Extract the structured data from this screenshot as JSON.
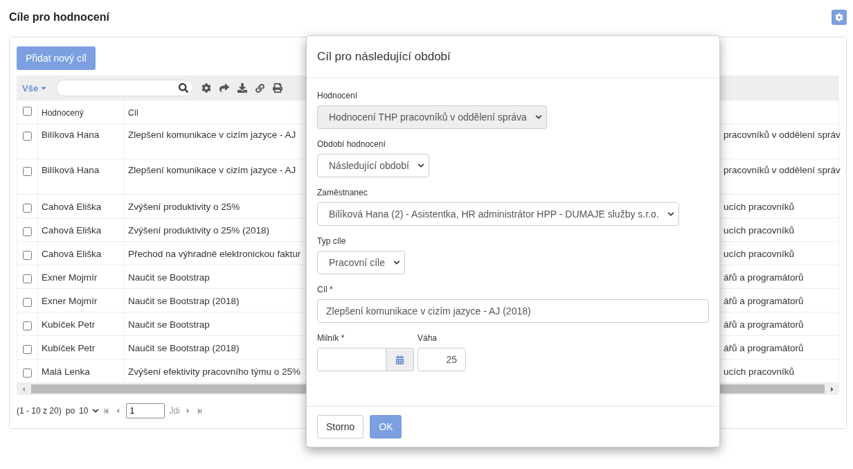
{
  "page": {
    "title": "Cíle pro hodnocení"
  },
  "add_button": "Přidat nový cíl",
  "toolbar": {
    "filter": "Vše"
  },
  "table": {
    "select_all": {
      "checked": false
    },
    "columns": [
      "Hodnocený",
      "Cíl"
    ],
    "rows": [
      {
        "checked": false,
        "tall": true,
        "person": "Bilíková Hana",
        "goal": "Zlepšení komunikace v cizím jazyce - AJ",
        "column_3": "pracovníků v oddělení správ"
      },
      {
        "checked": false,
        "tall": true,
        "person": "Bilíková Hana",
        "goal": "Zlepšení komunikace v cizím jazyce - AJ",
        "column_3": "pracovníků v oddělení správ"
      },
      {
        "checked": false,
        "tall": false,
        "person": "Cahová Eliška",
        "goal": "Zvýšení produktivity o 25%",
        "column_3": "ucích pracovníků"
      },
      {
        "checked": false,
        "tall": false,
        "person": "Cahová Eliška",
        "goal": "Zvýšení produktivity o 25% (2018)",
        "column_3": "ucích pracovníků"
      },
      {
        "checked": false,
        "tall": false,
        "person": "Cahová Eliška",
        "goal": "Přechod na výhradně elektronickou faktur",
        "column_3": "ucích pracovníků"
      },
      {
        "checked": false,
        "tall": false,
        "person": "Exner Mojmír",
        "goal": "Naučit se Bootstrap",
        "column_3": "ářů a programátorů"
      },
      {
        "checked": false,
        "tall": false,
        "person": "Exner Mojmír",
        "goal": "Naučit se Bootstrap (2018)",
        "column_3": "ářů a programátorů"
      },
      {
        "checked": false,
        "tall": false,
        "person": "Kubíček Petr",
        "goal": "Naučit se Bootstrap",
        "column_3": "ářů a programátorů"
      },
      {
        "checked": false,
        "tall": false,
        "person": "Kubíček Petr",
        "goal": "Naučit se Bootstrap (2018)",
        "column_3": "ářů a programátorů"
      },
      {
        "checked": false,
        "tall": false,
        "person": "Malá Lenka",
        "goal": "Zvýšení efektivity pracovního týmu o 25%",
        "column_3": "ucích pracovníků"
      }
    ]
  },
  "pagination": {
    "range": "(1 - 10 z 20)",
    "per_page_label": "po",
    "per_page": "10",
    "page": "1",
    "go": "Jdi"
  },
  "dialog": {
    "title": "Cíl pro následující období",
    "fields": [
      {
        "kind": "select",
        "label": "Hodnocení",
        "value": "Hodnocení THP pracovníků v oddělení správa",
        "disabled": true
      },
      {
        "kind": "select",
        "label": "Období hodnocení",
        "value": "Následující období",
        "disabled": false
      },
      {
        "kind": "select",
        "label": "Zaměstnanec",
        "value": "Bilíková Hana (2) - Asistentka, HR administrátor HPP - DUMAJE služby s.r.o.",
        "disabled": false
      },
      {
        "kind": "select",
        "label": "Typ cíle",
        "value": "Pracovní cíle",
        "disabled": false
      },
      {
        "kind": "text",
        "label": "Cíl *",
        "value": "Zlepšení komunikace v cizím jazyce - AJ (2018)",
        "disabled": false
      }
    ],
    "milestone": {
      "label": "Milník *"
    },
    "weight": {
      "label": "Váha",
      "value": "25"
    },
    "buttons": [
      {
        "kind": "default",
        "label": "Storno"
      },
      {
        "kind": "primary",
        "label": "OK"
      }
    ]
  }
}
